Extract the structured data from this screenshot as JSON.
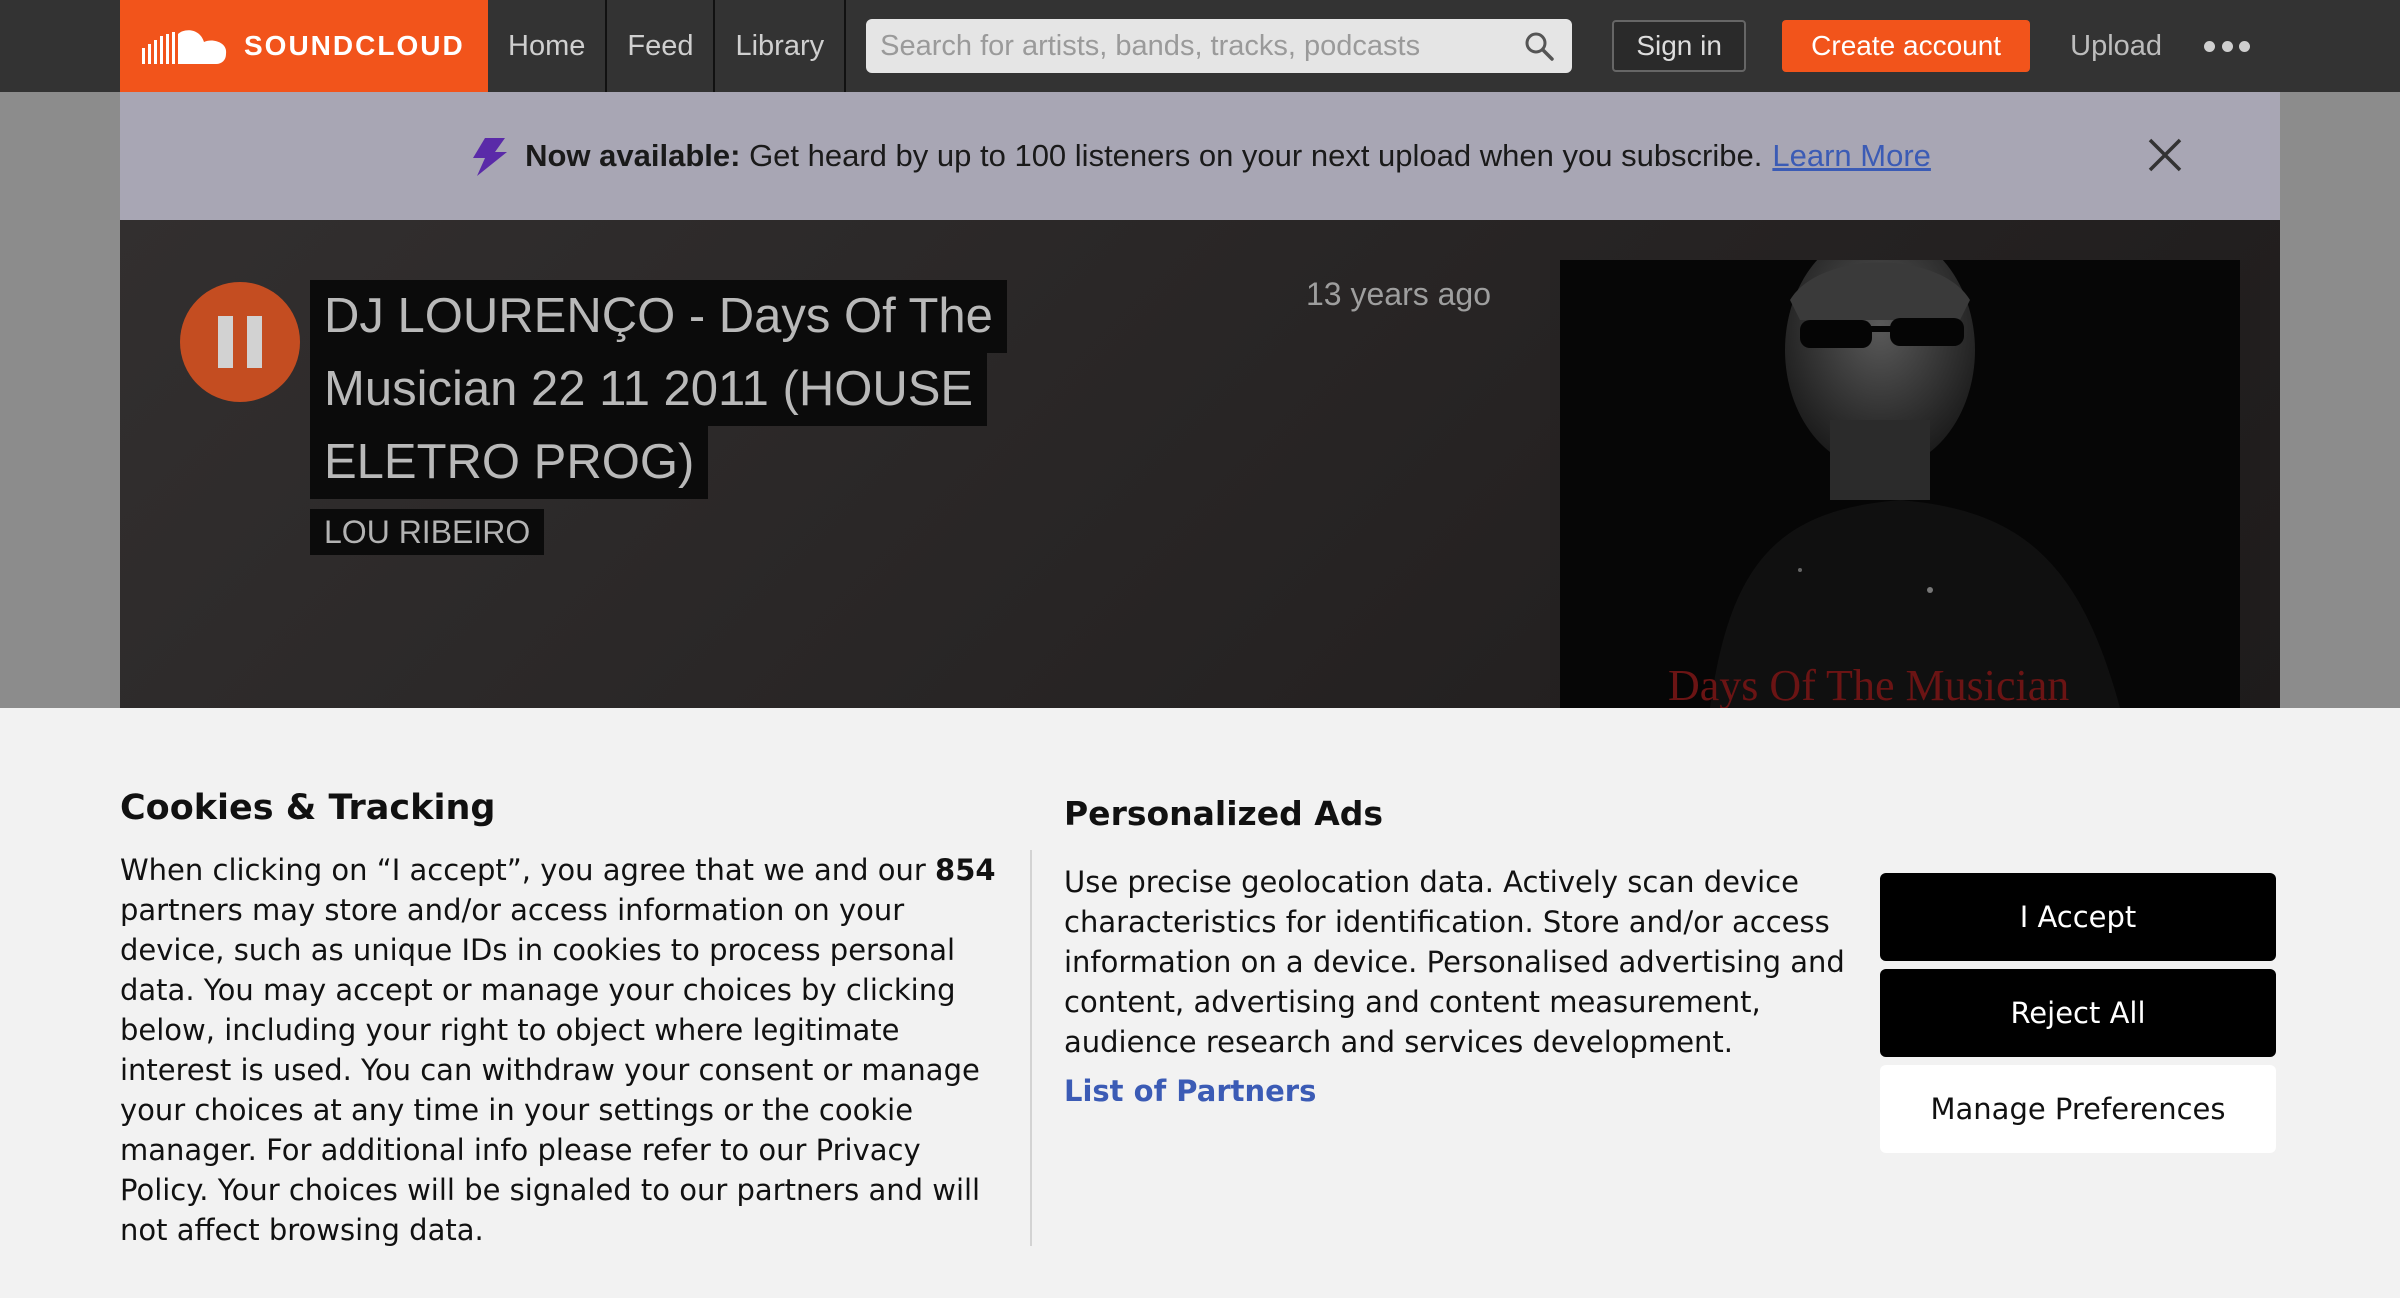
{
  "nav": {
    "logo_text": "SOUNDCLOUD",
    "links": [
      "Home",
      "Feed",
      "Library"
    ],
    "search_placeholder": "Search for artists, bands, tracks, podcasts",
    "sign_in": "Sign in",
    "create_account": "Create account",
    "upload": "Upload",
    "more_icon": "more-dots-icon",
    "brand_color": "#f2541b"
  },
  "announcement": {
    "bold": "Now available:",
    "text": "Get heard by up to 100 listeners on your next upload when you subscribe.",
    "link": "Learn More",
    "icon": "lightning-icon",
    "close_icon": "close-icon"
  },
  "track": {
    "title_lines": [
      "DJ LOURENÇO - Days Of The",
      "Musician 22 11 2011 (HOUSE",
      "ELETRO PROG)"
    ],
    "artist": "LOU RIBEIRO",
    "posted": "13 years ago",
    "artwork_caption": "Days Of The Musician",
    "state": "playing"
  },
  "cookies": {
    "heading": "Cookies & Tracking",
    "body_before": "When clicking on “I accept”, you agree that we and our ",
    "partner_count": "854",
    "body_after": " partners may store and/or access information on your device, such as unique IDs in cookies to process personal data. You may accept or manage your choices by clicking below, including your right to object where legitimate interest is used. You can withdraw your consent or manage your choices at any time in your settings or the cookie manager. For additional info please refer to our Privacy Policy. Your choices will be signaled to our partners and will not affect browsing data.",
    "ads_heading": "Personalized Ads",
    "ads_body": "Use precise geolocation data. Actively scan device characteristics for identification. Store and/or access information on a device. Personalised advertising and content, advertising and content measurement, audience research and services development.",
    "partners_link": "List of Partners",
    "accept": "I Accept",
    "reject": "Reject All",
    "manage": "Manage Preferences"
  }
}
